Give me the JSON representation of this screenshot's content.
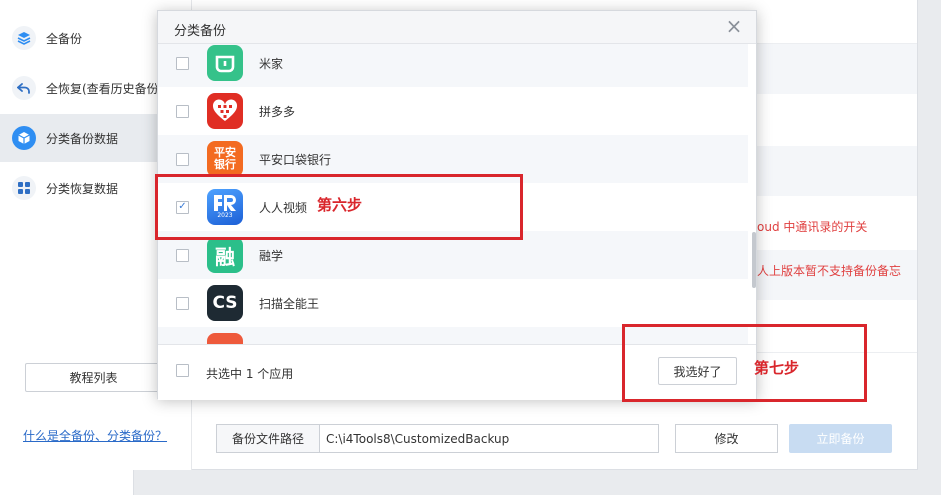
{
  "sidebar": {
    "items": [
      {
        "label": "全备份"
      },
      {
        "label": "全恢复(查看历史备份)"
      },
      {
        "label": "分类备份数据"
      },
      {
        "label": "分类恢复数据"
      }
    ],
    "tutorial_button": "教程列表",
    "help_link": "什么是全备份、分类备份？"
  },
  "main": {
    "notice_1": "oud 中通讯录的开关",
    "notice_2": "人上版本暂不支持备份备忘",
    "path_label": "备份文件路径",
    "path_value": "C:\\i4Tools8\\CustomizedBackup",
    "modify_button": "修改",
    "backup_now_button": "立即备份"
  },
  "modal": {
    "title": "分类备份",
    "close_glyph": "×",
    "apps": [
      {
        "name": "米家",
        "checked": false,
        "icon": "mijia-app-icon"
      },
      {
        "name": "拼多多",
        "checked": false,
        "icon": "pinduoduo-app-icon"
      },
      {
        "name": "平安口袋银行",
        "checked": false,
        "icon": "pingan-bank-app-icon",
        "icon_text_1": "平安",
        "icon_text_2": "银行"
      },
      {
        "name": "人人视频",
        "checked": true,
        "icon": "renren-video-app-icon",
        "icon_text": "2023"
      },
      {
        "name": "融学",
        "checked": false,
        "icon": "rongxue-app-icon",
        "icon_text": "融"
      },
      {
        "name": "扫描全能王",
        "checked": false,
        "icon": "camscanner-app-icon",
        "icon_text": "CS"
      }
    ],
    "check_glyph": "✓",
    "selected_count": "共选中 1 个应用",
    "done_button": "我选好了"
  },
  "annotations": {
    "step_six": "第六步",
    "step_seven": "第七步"
  },
  "colors": {
    "accent": "#2f8ef2",
    "annotation_red": "#d9262c",
    "warning_text": "#e04040"
  }
}
